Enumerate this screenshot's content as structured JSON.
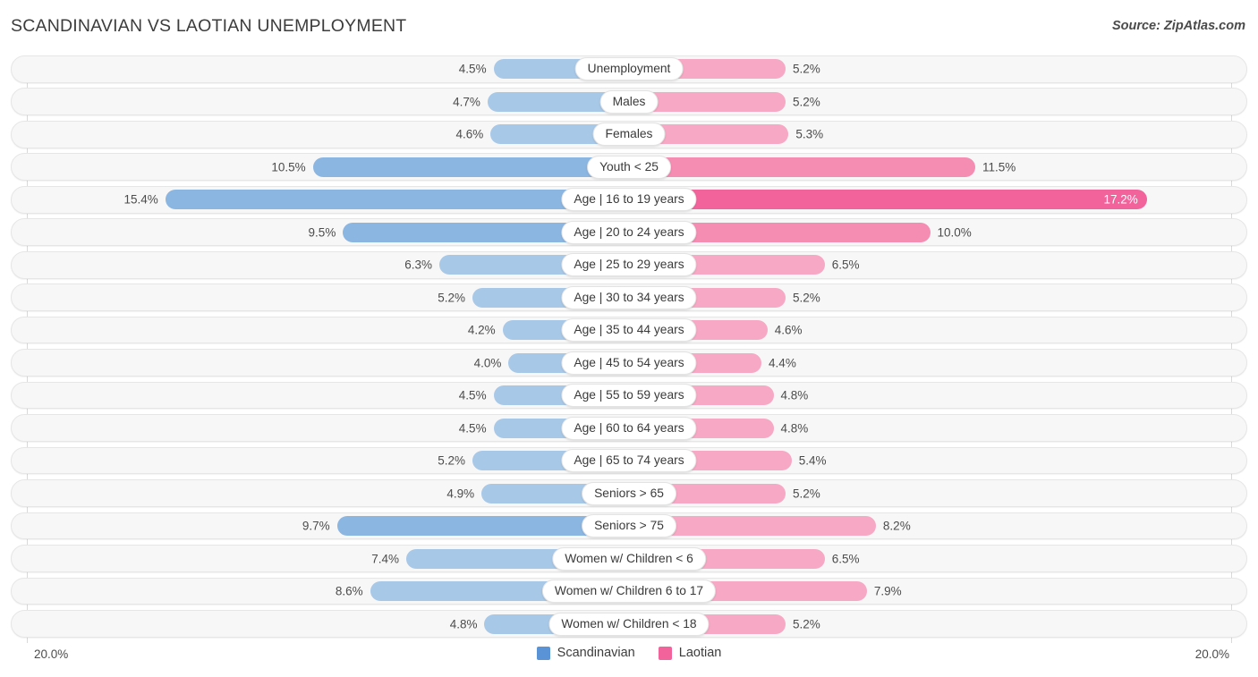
{
  "header": {
    "title": "SCANDINAVIAN VS LAOTIAN UNEMPLOYMENT",
    "source": "Source: ZipAtlas.com"
  },
  "axis": {
    "left_label": "20.0%",
    "right_label": "20.0%",
    "max": 20.0
  },
  "legend": [
    {
      "label": "Scandinavian",
      "color": "#5b94d6"
    },
    {
      "label": "Laotian",
      "color": "#f2639c"
    }
  ],
  "colors": {
    "left_light": "#a8c8e8",
    "left_mid": "#8cb6e2",
    "left_dark": "#5b94d6",
    "right_light": "#f7a8c4",
    "right_mid": "#f58cb2",
    "right_dark": "#f2639c",
    "track": "#f7f7f7",
    "track_border": "#e6e6e6"
  },
  "chart_data": {
    "type": "bar",
    "orientation": "horizontal-diverging",
    "title": "SCANDINAVIAN VS LAOTIAN UNEMPLOYMENT",
    "xlabel": "",
    "ylabel": "",
    "xlim": [
      20.0,
      20.0
    ],
    "grid": false,
    "legend_position": "bottom-center",
    "categories": [
      "Unemployment",
      "Males",
      "Females",
      "Youth < 25",
      "Age | 16 to 19 years",
      "Age | 20 to 24 years",
      "Age | 25 to 29 years",
      "Age | 30 to 34 years",
      "Age | 35 to 44 years",
      "Age | 45 to 54 years",
      "Age | 55 to 59 years",
      "Age | 60 to 64 years",
      "Age | 65 to 74 years",
      "Seniors > 65",
      "Seniors > 75",
      "Women w/ Children < 6",
      "Women w/ Children 6 to 17",
      "Women w/ Children < 18"
    ],
    "series": [
      {
        "name": "Scandinavian",
        "values": [
          4.5,
          4.7,
          4.6,
          10.5,
          15.4,
          9.5,
          6.3,
          5.2,
          4.2,
          4.0,
          4.5,
          4.5,
          5.2,
          4.9,
          9.7,
          7.4,
          8.6,
          4.8
        ],
        "labels": [
          "4.5%",
          "4.7%",
          "4.6%",
          "10.5%",
          "15.4%",
          "9.5%",
          "6.3%",
          "5.2%",
          "4.2%",
          "4.0%",
          "4.5%",
          "4.5%",
          "5.2%",
          "4.9%",
          "9.7%",
          "7.4%",
          "8.6%",
          "4.8%"
        ]
      },
      {
        "name": "Laotian",
        "values": [
          5.2,
          5.2,
          5.3,
          11.5,
          17.2,
          10.0,
          6.5,
          5.2,
          4.6,
          4.4,
          4.8,
          4.8,
          5.4,
          5.2,
          8.2,
          6.5,
          7.9,
          5.2
        ],
        "labels": [
          "5.2%",
          "5.2%",
          "5.3%",
          "11.5%",
          "17.2%",
          "10.0%",
          "6.5%",
          "5.2%",
          "4.6%",
          "4.4%",
          "4.8%",
          "4.8%",
          "5.4%",
          "5.2%",
          "8.2%",
          "6.5%",
          "7.9%",
          "5.2%"
        ]
      }
    ]
  }
}
